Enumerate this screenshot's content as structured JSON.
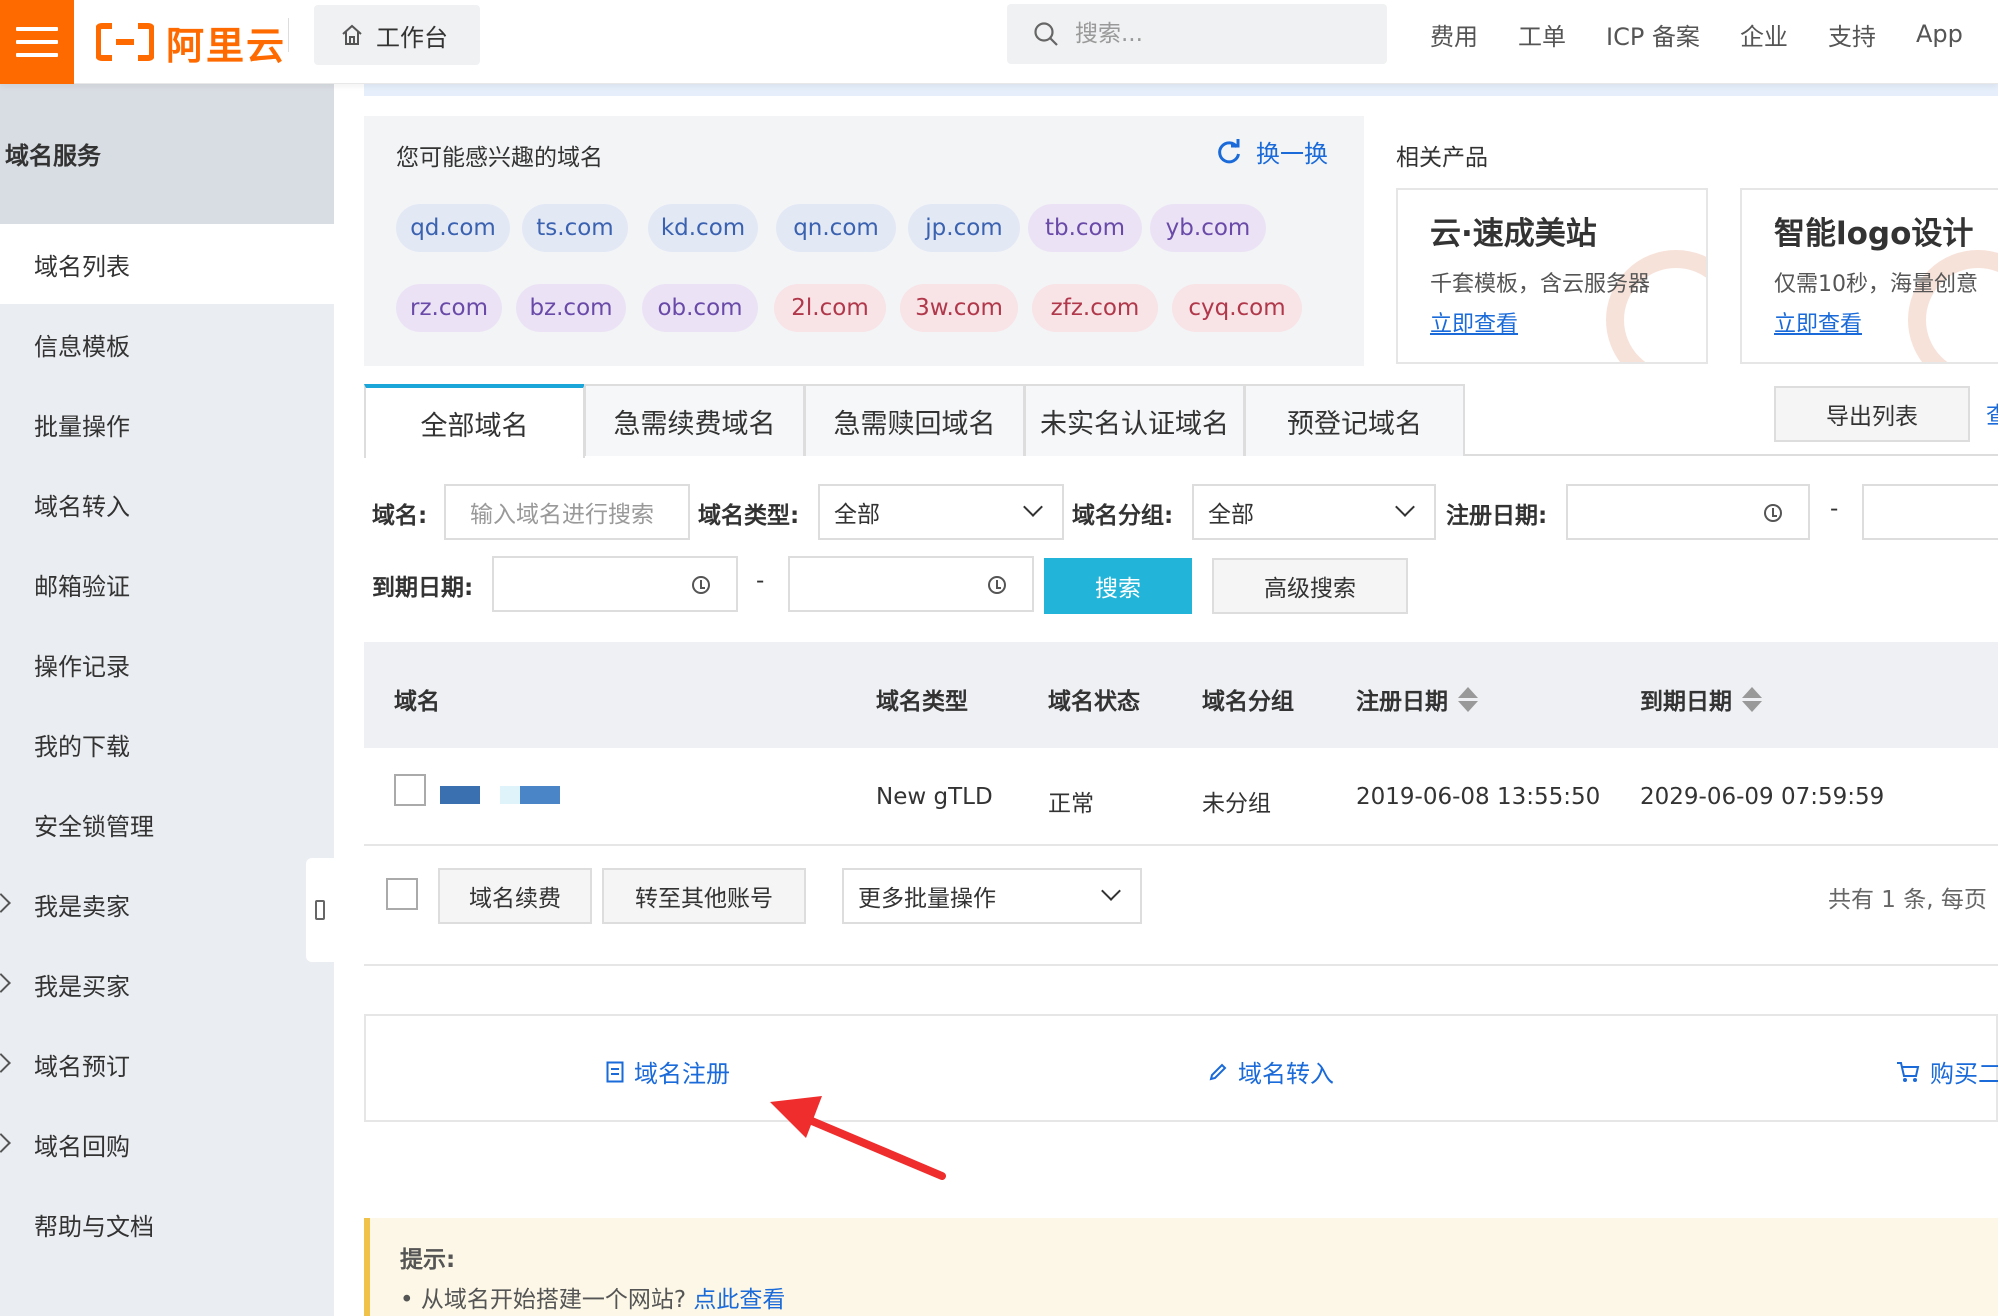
{
  "header": {
    "logo_text": "阿里云",
    "workbench_label": "工作台",
    "search_placeholder": "搜索...",
    "nav": [
      "费用",
      "工单",
      "ICP 备案",
      "企业",
      "支持",
      "App"
    ],
    "brand_color": "#ff6a00"
  },
  "sidebar": {
    "title": "域名服务",
    "items": [
      {
        "label": "域名列表",
        "active": true,
        "expandable": false
      },
      {
        "label": "信息模板",
        "active": false,
        "expandable": false
      },
      {
        "label": "批量操作",
        "active": false,
        "expandable": false
      },
      {
        "label": "域名转入",
        "active": false,
        "expandable": false
      },
      {
        "label": "邮箱验证",
        "active": false,
        "expandable": false
      },
      {
        "label": "操作记录",
        "active": false,
        "expandable": false
      },
      {
        "label": "我的下载",
        "active": false,
        "expandable": false
      },
      {
        "label": "安全锁管理",
        "active": false,
        "expandable": false
      },
      {
        "label": "我是卖家",
        "active": false,
        "expandable": true
      },
      {
        "label": "我是买家",
        "active": false,
        "expandable": true
      },
      {
        "label": "域名预订",
        "active": false,
        "expandable": true
      },
      {
        "label": "域名回购",
        "active": false,
        "expandable": true
      },
      {
        "label": "帮助与文档",
        "active": false,
        "expandable": false
      }
    ]
  },
  "suggest": {
    "title": "您可能感兴趣的域名",
    "refresh_label": "换一换",
    "domains_row1": [
      "qd.com",
      "ts.com",
      "kd.com",
      "qn.com",
      "jp.com",
      "tb.com",
      "yb.com"
    ],
    "domains_row2": [
      "rz.com",
      "bz.com",
      "ob.com",
      "2l.com",
      "3w.com",
      "zfz.com",
      "cyq.com"
    ]
  },
  "related": {
    "title": "相关产品",
    "products": [
      {
        "title": "云·速成美站",
        "desc": "千套模板，含云服务器",
        "link": "立即查看"
      },
      {
        "title": "智能logo设计",
        "desc": "仅需10秒，海量创意",
        "link": "立即查看"
      }
    ]
  },
  "tabs": [
    "全部域名",
    "急需续费域名",
    "急需赎回域名",
    "未实名认证域名",
    "预登记域名"
  ],
  "export_label": "导出列表",
  "export_extra": "查",
  "filters": {
    "domain_label": "域名:",
    "domain_placeholder": "输入域名进行搜索",
    "type_label": "域名类型:",
    "type_value": "全部",
    "group_label": "域名分组:",
    "group_value": "全部",
    "reg_date_label": "注册日期:",
    "exp_date_label": "到期日期:",
    "dash": "-",
    "search_label": "搜索",
    "advanced_label": "高级搜索"
  },
  "table": {
    "columns": [
      "域名",
      "域名类型",
      "域名状态",
      "域名分组",
      "注册日期",
      "到期日期"
    ],
    "rows": [
      {
        "type": "New gTLD",
        "status": "正常",
        "group": "未分组",
        "reg_date": "2019-06-08 13:55:50",
        "exp_date": "2029-06-09 07:59:59"
      }
    ]
  },
  "batch": {
    "renew_label": "域名续费",
    "transfer_label": "转至其他账号",
    "more_label": "更多批量操作",
    "total_text": "共有 1 条,  每页"
  },
  "actions": {
    "register": "域名注册",
    "transfer_in": "域名转入",
    "buy": "购买二"
  },
  "tip": {
    "title": "提示:",
    "text": "• 从域名开始搭建一个网站?",
    "link": "点此查看"
  }
}
